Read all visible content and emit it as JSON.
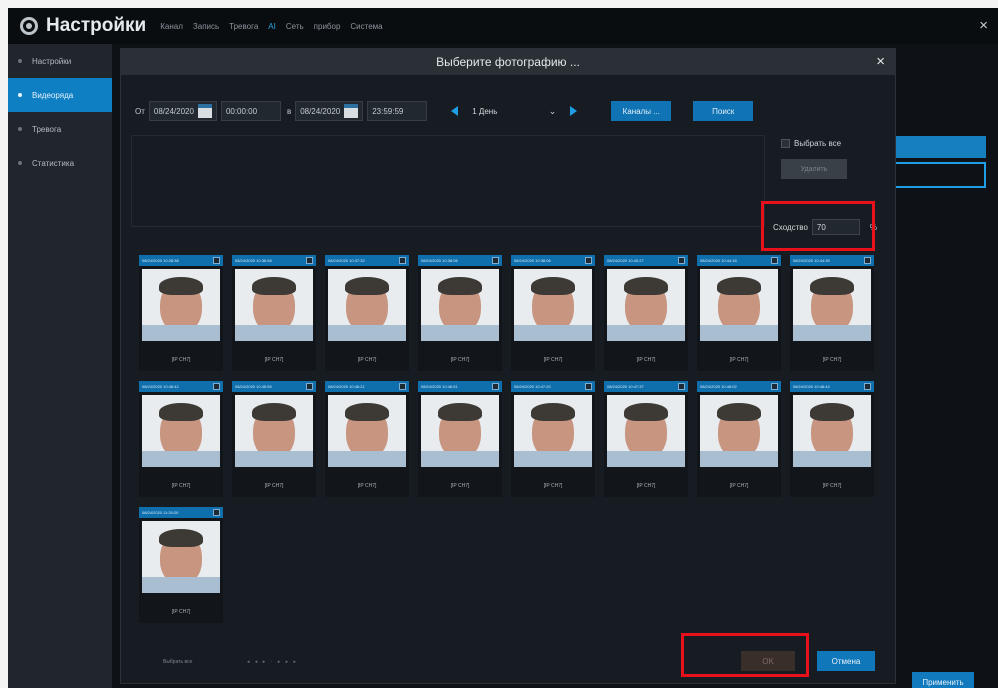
{
  "app": {
    "title": "Настройки",
    "menu": [
      "Канал",
      "Запись",
      "Тревога",
      "AI",
      "Сеть",
      "прибор",
      "Система"
    ],
    "active_menu": "AI",
    "close_label": "×",
    "apply_label": "Применить"
  },
  "sidebar": {
    "items": [
      {
        "label": "Настройки",
        "active": false
      },
      {
        "label": "Видеоряда",
        "active": true
      },
      {
        "label": "Тревога",
        "active": false
      },
      {
        "label": "Статистика",
        "active": false
      }
    ]
  },
  "dialog": {
    "title": "Выберите фотографию ...",
    "close_label": "×",
    "from_label": "От",
    "from_date": "08/24/2020",
    "from_time": "00:00:00",
    "to_label": "в",
    "to_date": "08/24/2020",
    "to_time": "23:59:59",
    "period": "1 День",
    "channels_label": "Каналы ...",
    "search_label": "Поиск",
    "select_all_label": "Выбрать все",
    "delete_label": "Удалить",
    "similarity_label": "Сходство",
    "similarity_value": "70",
    "similarity_unit": "%",
    "ok_label": "OK",
    "cancel_label": "Отмена",
    "footer_text": "Выбрать все"
  },
  "results": [
    {
      "time": "08/24/2020 10:28:38",
      "label": "[IP CH7]"
    },
    {
      "time": "08/24/2020 10:36:58",
      "label": "[IP CH7]"
    },
    {
      "time": "08/24/2020 10:37:32",
      "label": "[IP CH7]"
    },
    {
      "time": "08/24/2020 10:38:06",
      "label": "[IP CH7]"
    },
    {
      "time": "08/24/2020 10:38:06",
      "label": "[IP CH7]"
    },
    {
      "time": "08/24/2020 10:40:27",
      "label": "[IP CH7]"
    },
    {
      "time": "08/24/2020 10:44:18",
      "label": "[IP CH7]"
    },
    {
      "time": "08/24/2020 10:44:35",
      "label": "[IP CH7]"
    },
    {
      "time": "08/24/2020 10:46:42",
      "label": "[IP CH7]"
    },
    {
      "time": "08/24/2020 10:45:59",
      "label": "[IP CH7]"
    },
    {
      "time": "08/24/2020 10:46:21",
      "label": "[IP CH7]"
    },
    {
      "time": "08/24/2020 10:46:51",
      "label": "[IP CH7]"
    },
    {
      "time": "08/24/2020 10:47:20",
      "label": "[IP CH7]"
    },
    {
      "time": "08/24/2020 10:47:37",
      "label": "[IP CH7]"
    },
    {
      "time": "08/24/2020 10:48:02",
      "label": "[IP CH7]"
    },
    {
      "time": "08/24/2020 10:48:44",
      "label": "[IP CH7]"
    },
    {
      "time": "08/24/2020 11:20:20",
      "label": "[IP CH7]"
    }
  ],
  "colors": {
    "accent": "#0f73b4",
    "highlight": "#e8111b"
  }
}
